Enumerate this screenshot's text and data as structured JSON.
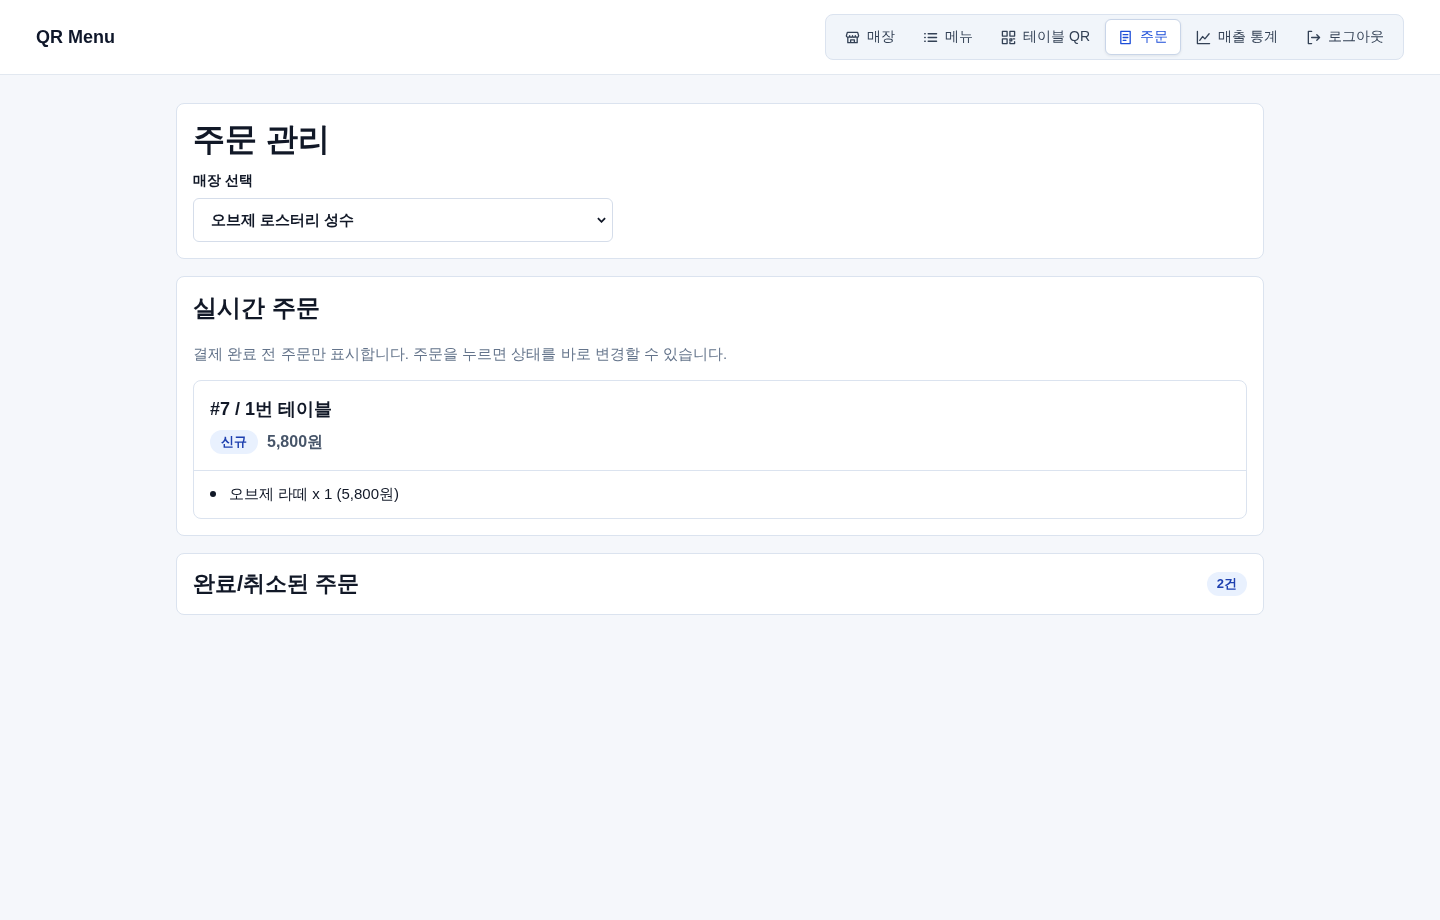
{
  "header": {
    "logo": "QR Menu",
    "nav": [
      {
        "label": "매장",
        "selected": false
      },
      {
        "label": "메뉴",
        "selected": false
      },
      {
        "label": "테이블 QR",
        "selected": false
      },
      {
        "label": "주문",
        "selected": true
      },
      {
        "label": "매출 통계",
        "selected": false
      },
      {
        "label": "로그아웃",
        "selected": false
      }
    ]
  },
  "management": {
    "title": "주문 관리",
    "store_label": "매장 선택",
    "store_select": {
      "value": "오브제 로스터리 성수"
    }
  },
  "live_orders": {
    "title": "실시간 주문",
    "description": "결제 완료 전 주문만 표시합니다. 주문을 누르면 상태를 바로 변경할 수 있습니다.",
    "orders": [
      {
        "title": "#7 / 1번 테이블",
        "status": "신규",
        "total": "5,800원",
        "items": [
          "오브제 라떼 x 1 (5,800원)"
        ]
      }
    ]
  },
  "completed_orders": {
    "title": "완료/취소된 주문",
    "count": "2건"
  }
}
